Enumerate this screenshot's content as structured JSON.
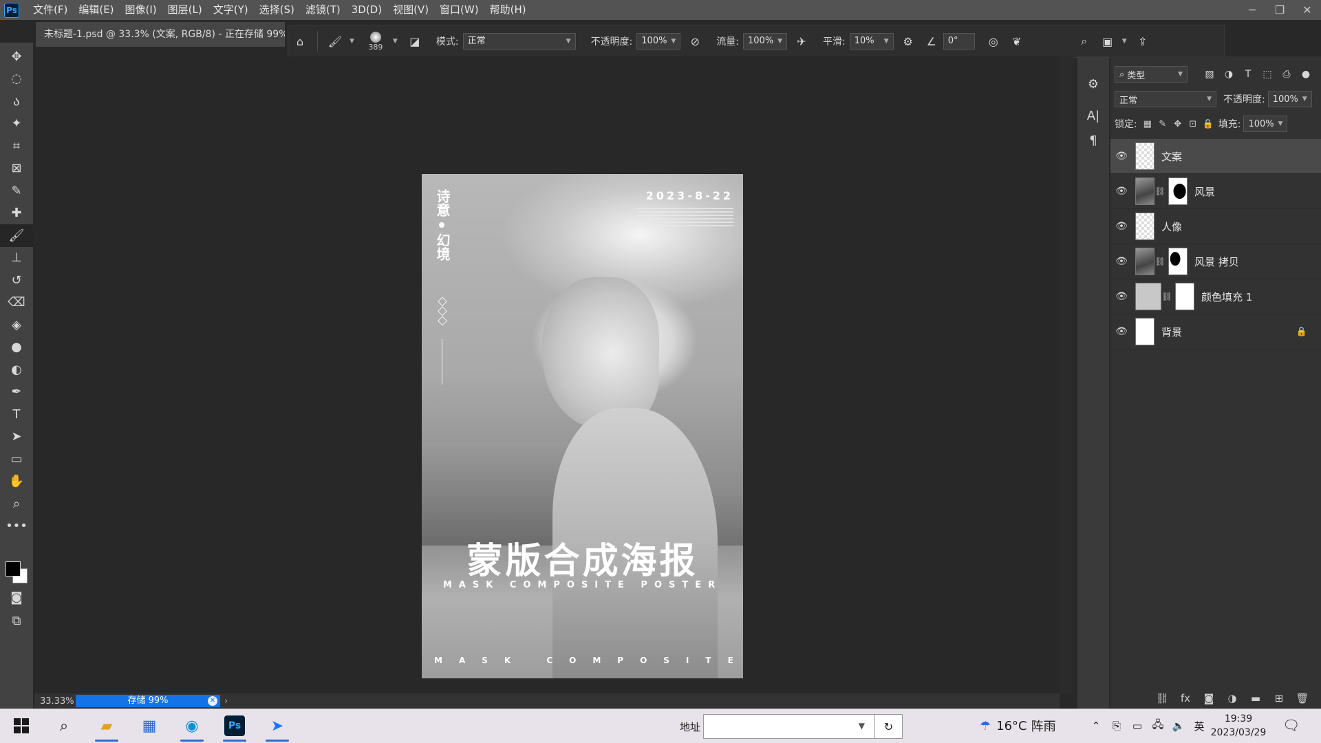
{
  "app": {
    "logo": "Ps",
    "menu": [
      "文件(F)",
      "编辑(E)",
      "图像(I)",
      "图层(L)",
      "文字(Y)",
      "选择(S)",
      "滤镜(T)",
      "3D(D)",
      "视图(V)",
      "窗口(W)",
      "帮助(H)"
    ],
    "window_controls": {
      "minimize": "─",
      "restore": "❐",
      "close": "✕"
    }
  },
  "document_tab": {
    "title": "未标题-1.psd @ 33.3% (文案, RGB/8) - 正在存储 99%"
  },
  "options_bar": {
    "brush_size": "389",
    "mode_label": "模式:",
    "mode_value": "正常",
    "opacity_label": "不透明度:",
    "opacity_value": "100%",
    "flow_label": "流量:",
    "flow_value": "100%",
    "smoothing_label": "平滑:",
    "smoothing_value": "10%",
    "angle_value": "0°"
  },
  "toolbar": {
    "tools": [
      {
        "name": "move-tool",
        "glyph": "✥"
      },
      {
        "name": "marquee-tool",
        "glyph": "◌"
      },
      {
        "name": "lasso-tool",
        "glyph": "ა"
      },
      {
        "name": "magic-wand-tool",
        "glyph": "✦"
      },
      {
        "name": "crop-tool",
        "glyph": "⌗"
      },
      {
        "name": "frame-tool",
        "glyph": "⊠"
      },
      {
        "name": "eyedropper-tool",
        "glyph": "✎"
      },
      {
        "name": "healing-brush-tool",
        "glyph": "✚"
      },
      {
        "name": "brush-tool",
        "glyph": "🖌"
      },
      {
        "name": "clone-stamp-tool",
        "glyph": "⊥"
      },
      {
        "name": "history-brush-tool",
        "glyph": "↺"
      },
      {
        "name": "eraser-tool",
        "glyph": "⌫"
      },
      {
        "name": "paint-bucket-tool",
        "glyph": "◈"
      },
      {
        "name": "blur-tool",
        "glyph": "●"
      },
      {
        "name": "dodge-tool",
        "glyph": "◐"
      },
      {
        "name": "pen-tool",
        "glyph": "✒"
      },
      {
        "name": "type-tool",
        "glyph": "T"
      },
      {
        "name": "path-selection-tool",
        "glyph": "➤"
      },
      {
        "name": "rectangle-tool",
        "glyph": "▭"
      },
      {
        "name": "hand-tool",
        "glyph": "✋"
      },
      {
        "name": "zoom-tool",
        "glyph": "⌕"
      },
      {
        "name": "more-tools",
        "glyph": "•••"
      }
    ],
    "active_tool": "brush-tool"
  },
  "poster": {
    "vertical_text_top": "诗意",
    "vertical_text_bottom": "幻境",
    "date": "2023-8-22",
    "title": "蒙版合成海报",
    "subtitle": "MASK COMPOSITE POSTER",
    "bottom_text": "MASK COMPOSITE POSTER"
  },
  "status": {
    "zoom": "33.33%",
    "progress_label": "存储 99%",
    "progress_value": 0.99
  },
  "layers_panel": {
    "filter_label": "类型",
    "blend_mode": "正常",
    "opacity_label": "不透明度:",
    "opacity_value": "100%",
    "lock_label": "锁定:",
    "fill_label": "填充:",
    "fill_value": "100%",
    "layers": [
      {
        "name": "文案",
        "selected": true
      },
      {
        "name": "风景",
        "selected": false
      },
      {
        "name": "人像",
        "selected": false
      },
      {
        "name": "风景 拷贝",
        "selected": false
      },
      {
        "name": "颜色填充 1",
        "selected": false
      },
      {
        "name": "背景",
        "selected": false,
        "locked": true
      }
    ]
  },
  "taskbar": {
    "address_label": "地址",
    "weather_temp": "16°C",
    "weather_desc": "阵雨",
    "ime": "英",
    "time": "19:39",
    "date": "2023/03/29"
  }
}
